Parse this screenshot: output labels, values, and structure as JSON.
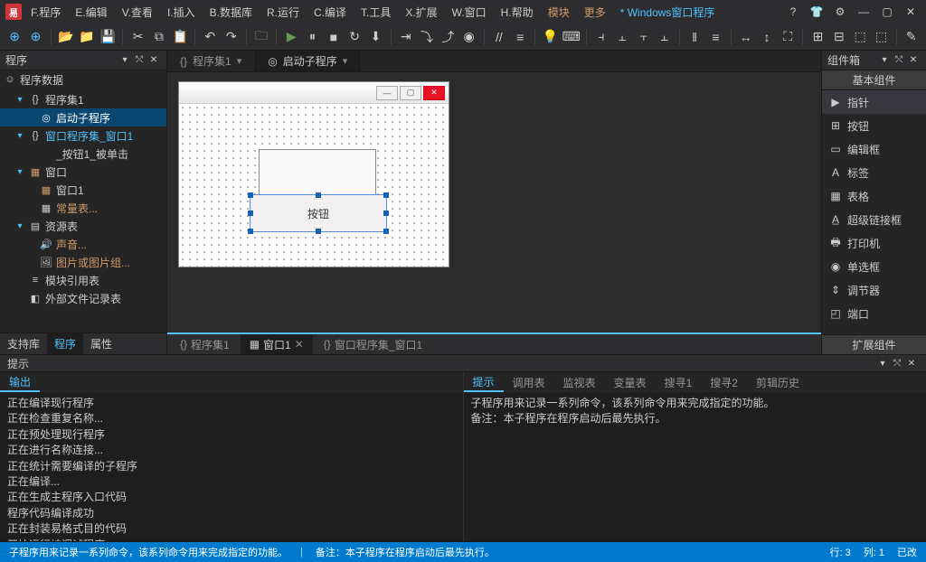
{
  "menus": [
    "F.程序",
    "E.编辑",
    "V.查看",
    "I.插入",
    "B.数据库",
    "R.运行",
    "C.编译",
    "T.工具",
    "X.扩展",
    "W.窗口",
    "H.帮助"
  ],
  "menu_extras": {
    "modules": "模块",
    "more": "更多"
  },
  "doc_title": "* Windows窗口程序",
  "left_panel": {
    "title": "程序",
    "root": "程序数据"
  },
  "tree": [
    {
      "label": "程序集1",
      "type": "caret",
      "icon": "{}",
      "depth": 1,
      "selected": false
    },
    {
      "label": "启动子程序",
      "type": "node",
      "icon": "◎",
      "depth": 2,
      "selected": true
    },
    {
      "label": "窗口程序集_窗口1",
      "type": "caret",
      "icon": "{}",
      "depth": 1,
      "selected": false,
      "blue": true
    },
    {
      "label": "_按钮1_被单击",
      "type": "node",
      "icon": "",
      "depth": 2,
      "selected": false
    },
    {
      "label": "窗口",
      "type": "caret",
      "icon": "▦",
      "depth": 1,
      "selected": false,
      "orangeIcon": true
    },
    {
      "label": "窗口1",
      "type": "node",
      "icon": "▦",
      "depth": 2,
      "selected": false,
      "orangeIcon": true
    },
    {
      "label": "常量表...",
      "type": "node",
      "icon": "▦",
      "depth": 2,
      "selected": false,
      "orange": true
    },
    {
      "label": "资源表",
      "type": "caret",
      "icon": "▤",
      "depth": 1,
      "selected": false
    },
    {
      "label": "声音...",
      "type": "node",
      "icon": "🔊",
      "depth": 2,
      "selected": false,
      "orange": true
    },
    {
      "label": "图片或图片组...",
      "type": "node",
      "icon": "🖼",
      "depth": 2,
      "selected": false,
      "orange": true
    },
    {
      "label": "模块引用表",
      "type": "node",
      "icon": "≡",
      "depth": 1,
      "selected": false
    },
    {
      "label": "外部文件记录表",
      "type": "node",
      "icon": "◧",
      "depth": 1,
      "selected": false
    }
  ],
  "left_tabs": [
    "支持库",
    "程序",
    "属性"
  ],
  "editor_tabs": [
    {
      "label": "程序集1",
      "icon": "{}",
      "active": false
    },
    {
      "label": "启动子程序",
      "icon": "◎",
      "active": true
    }
  ],
  "designer": {
    "button_label": "按钮"
  },
  "center_bottom_tabs": [
    {
      "label": "程序集1",
      "icon": "{}",
      "active": false
    },
    {
      "label": "窗口1",
      "icon": "▦",
      "active": true,
      "closable": true
    },
    {
      "label": "窗口程序集_窗口1",
      "icon": "{}",
      "active": false
    }
  ],
  "right_panel": {
    "title": "组件箱",
    "section_header": "基本组件",
    "footer": "扩展组件",
    "items": [
      {
        "icon": "▶",
        "label": "指针",
        "selected": true
      },
      {
        "icon": "⊞",
        "label": "按钮"
      },
      {
        "icon": "▭",
        "label": "编辑框"
      },
      {
        "icon": "A",
        "label": "标签"
      },
      {
        "icon": "▦",
        "label": "表格"
      },
      {
        "icon": "A̲",
        "label": "超级链接框"
      },
      {
        "icon": "🖶",
        "label": "打印机"
      },
      {
        "icon": "◉",
        "label": "单选框"
      },
      {
        "icon": "⇕",
        "label": "调节器"
      },
      {
        "icon": "◰",
        "label": "端口"
      }
    ]
  },
  "hints_label": "提示",
  "output": {
    "tab": "输出",
    "lines": "正在编译现行程序\n正在检查重复名称...\n正在预处理现行程序\n正在进行名称连接...\n正在统计需要编译的子程序\n正在编译...\n正在生成主程序入口代码\n程序代码编译成功\n正在封装易格式目的代码\n开始运行被调试程序\n被调试易程序运行完毕"
  },
  "right_bottom": {
    "tabs": [
      "提示",
      "调用表",
      "监视表",
      "变量表",
      "搜寻1",
      "搜寻2",
      "剪辑历史"
    ],
    "content": "子程序用来记录一系列命令，该系列命令用来完成指定的功能。\n备注：本子程序在程序启动后最先执行。"
  },
  "status": {
    "left1": "子程序用来记录一系列命令，该系列命令用来完成指定的功能。",
    "left2": "备注：本子程序在程序启动后最先执行。",
    "row": "行: 3",
    "col": "列: 1",
    "mod": "已改"
  }
}
